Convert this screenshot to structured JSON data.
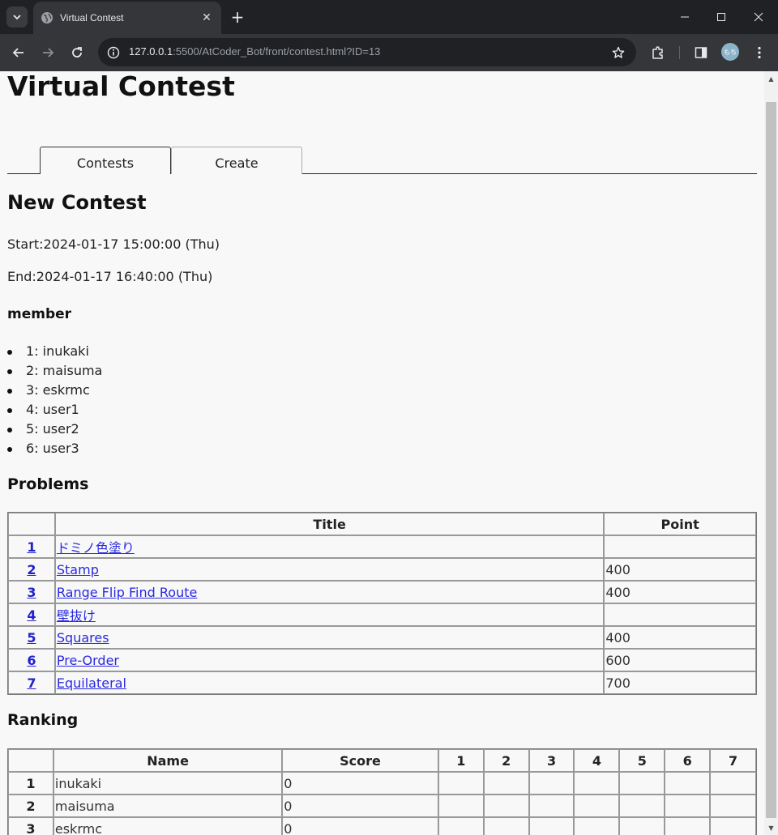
{
  "browser": {
    "tab_title": "Virtual Contest",
    "url_host": "127.0.0.1",
    "url_rest": ":5500/AtCoder_Bot/front/contest.html?ID=13",
    "avatar_text": "もち"
  },
  "page": {
    "title": "Virtual Contest",
    "tabs": [
      {
        "label": "Contests"
      },
      {
        "label": "Create"
      }
    ],
    "contest_name": "New Contest",
    "start": "Start:2024-01-17 15:00:00 (Thu)",
    "end": "End:2024-01-17 16:40:00 (Thu)",
    "member_heading": "member",
    "members": [
      "1: inukaki",
      "2: maisuma",
      "3: eskrmc",
      "4: user1",
      "5: user2",
      "6: user3"
    ],
    "problems_heading": "Problems",
    "problems_headers": [
      "",
      "Title",
      "Point"
    ],
    "problems": [
      {
        "num": "1",
        "title": "ドミノ色塗り",
        "point": ""
      },
      {
        "num": "2",
        "title": "Stamp",
        "point": "400"
      },
      {
        "num": "3",
        "title": "Range Flip Find Route",
        "point": "400"
      },
      {
        "num": "4",
        "title": "壁抜け",
        "point": ""
      },
      {
        "num": "5",
        "title": "Squares",
        "point": "400"
      },
      {
        "num": "6",
        "title": "Pre-Order",
        "point": "600"
      },
      {
        "num": "7",
        "title": "Equilateral",
        "point": "700"
      }
    ],
    "ranking_heading": "Ranking",
    "ranking_headers": [
      "",
      "Name",
      "Score",
      "1",
      "2",
      "3",
      "4",
      "5",
      "6",
      "7"
    ],
    "ranking": [
      {
        "rank": "1",
        "name": "inukaki",
        "score": "0"
      },
      {
        "rank": "2",
        "name": "maisuma",
        "score": "0"
      },
      {
        "rank": "3",
        "name": "eskrmc",
        "score": "0"
      }
    ]
  },
  "icons": {
    "tab_menu": "chevron-down-icon",
    "favicon": "globe-icon",
    "close": "close-icon",
    "new_tab": "plus-icon",
    "back": "arrow-left-icon",
    "forward": "arrow-right-icon",
    "reload": "reload-icon",
    "site_info": "site-info-icon",
    "bookmark": "star-icon",
    "extensions": "puzzle-icon",
    "side_panel": "side-panel-icon",
    "menu": "kebab-menu-icon"
  }
}
